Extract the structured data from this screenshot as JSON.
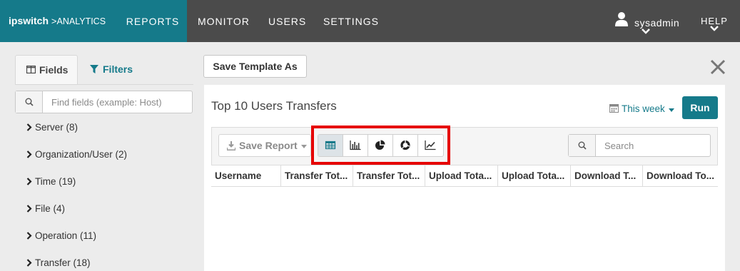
{
  "brand": {
    "name_bold": "ipswitch",
    "separator": ">",
    "product": "ANALYTICS"
  },
  "nav": {
    "reports": "REPORTS",
    "monitor": "MONITOR",
    "users": "USERS",
    "settings": "SETTINGS",
    "help": "HELP"
  },
  "user": {
    "name": "sysadmin"
  },
  "sidebar": {
    "tabs": {
      "fields": "Fields",
      "filters": "Filters"
    },
    "search_placeholder": "Find fields (example: Host)",
    "groups": [
      "Server (8)",
      "Organization/User (2)",
      "Time (19)",
      "File (4)",
      "Operation (11)",
      "Transfer (18)"
    ]
  },
  "toolbar": {
    "save_template": "Save Template As"
  },
  "report": {
    "title": "Top 10 Users Transfers",
    "date_range": "This week",
    "run": "Run",
    "save_report": "Save Report",
    "search_placeholder": "Search",
    "view_modes": [
      "table-icon",
      "bar-chart-icon",
      "pie-chart-icon",
      "donut-chart-icon",
      "line-chart-icon"
    ],
    "active_view": "table",
    "columns": [
      "Username",
      "Transfer Tot...",
      "Transfer Tot...",
      "Upload Tota...",
      "Upload Tota...",
      "Download T...",
      "Download To..."
    ]
  },
  "colors": {
    "accent": "#157a8a",
    "nav_bg": "#4b4b4b",
    "highlight": "#e60000"
  }
}
